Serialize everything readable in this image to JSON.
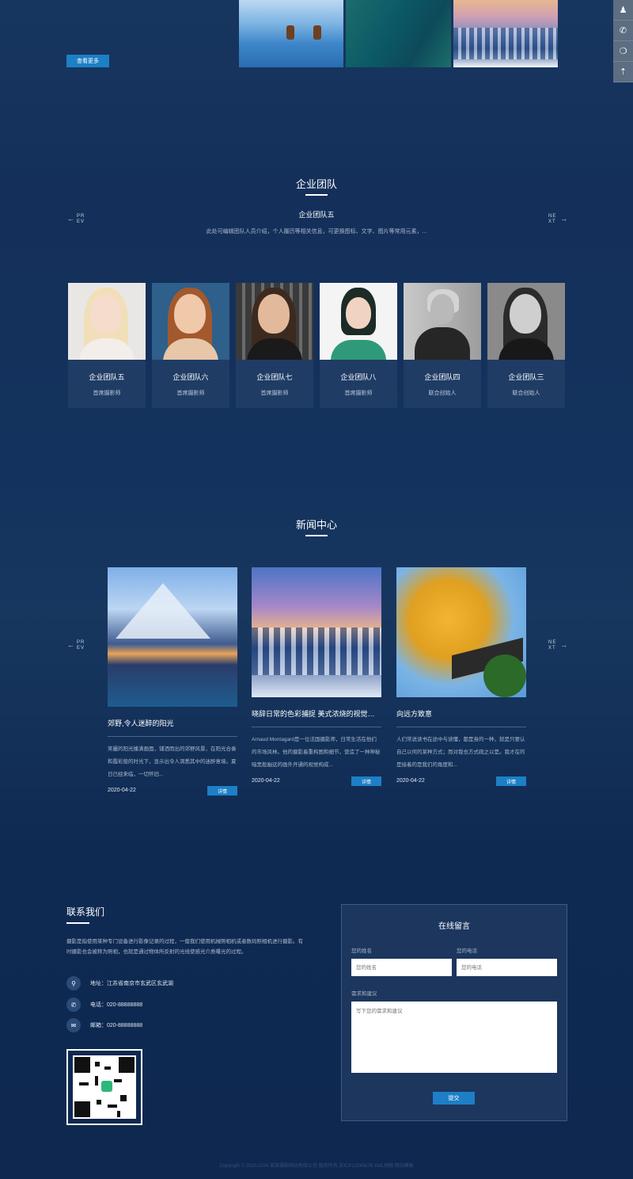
{
  "top": {
    "more_button": "查看更多",
    "float_bar": [
      "qq-icon",
      "phone-icon",
      "wechat-icon",
      "back-to-top-icon"
    ]
  },
  "team": {
    "title": "企业团队",
    "featured_name": "企业团队五",
    "featured_desc": "此处可编辑团队人员介绍，个人履历等相关信息，可更换图标、文字、图片等常用元素，...",
    "prev_label": "PR EV",
    "next_label": "NE XT",
    "members": [
      {
        "name": "企业团队五",
        "role": "首席摄影师"
      },
      {
        "name": "企业团队六",
        "role": "首席摄影师"
      },
      {
        "name": "企业团队七",
        "role": "首席摄影师"
      },
      {
        "name": "企业团队八",
        "role": "首席摄影师"
      },
      {
        "name": "企业团队四",
        "role": "联合创始人"
      },
      {
        "name": "企业团队三",
        "role": "联合创始人"
      }
    ]
  },
  "news": {
    "title": "新闻中心",
    "prev_label": "PR EV",
    "next_label": "NE XT",
    "items": [
      {
        "title": "郊野,令人迷醉的阳光",
        "text": "笑靥的阳光播满画面，铺洒而出的郊野风景，在阳光合奏和霞彩般的时光下，显示出令人洞悉其中的迷醉意境。夏日已经来临，一切怀旧...",
        "date": "2020-04-22",
        "button": "详情"
      },
      {
        "title": "晓辞日常的色彩捕捉 美式浓烧的视觉享受",
        "text": "Arnaud Montagard是一位法国摄影师，日常生活在他们的市场风林。他的摄影着重构图和细节，营造了一种神秘暗黑般幽远的画外开通的视觉构成...",
        "date": "2020-04-22",
        "button": "详情"
      },
      {
        "title": "向远方致意",
        "text": "人们常说读书在途中与读懂，都是身的一种，就是只要认自己以何的某种方式；而对我也方式疏之以是。我才在的是接着的是我们的角度和...",
        "date": "2020-04-22",
        "button": "详情"
      }
    ]
  },
  "contact": {
    "title": "联系我们",
    "intro": "摄影是指使用某种专门设备进行影像记录的过程，一般我们使用机械照相机或者数码照相机进行摄影。有时摄影也会被称为照相，也就是通过物体所反射的光线使感光介质曝光的过程。",
    "address_label": "地址：",
    "address": "江苏省南京市玄武区玄武湖",
    "phone_label": "电话：",
    "phone": "020-88888888",
    "email_label": "邮箱：",
    "email": "020-88888888"
  },
  "form": {
    "title": "在线留言",
    "name_label": "您的姓名",
    "name_placeholder": "您的姓名",
    "phone_label": "您的电话",
    "phone_placeholder": "您的电话",
    "message_label": "需求和建议",
    "message_placeholder": "写下您的需求和建议",
    "submit": "提交"
  },
  "footer": {
    "copyright": "Copyright © 2020-2024 某某摄影网站有限公司 版权所有 苏ICP12345678 XML地图 网站模板"
  }
}
